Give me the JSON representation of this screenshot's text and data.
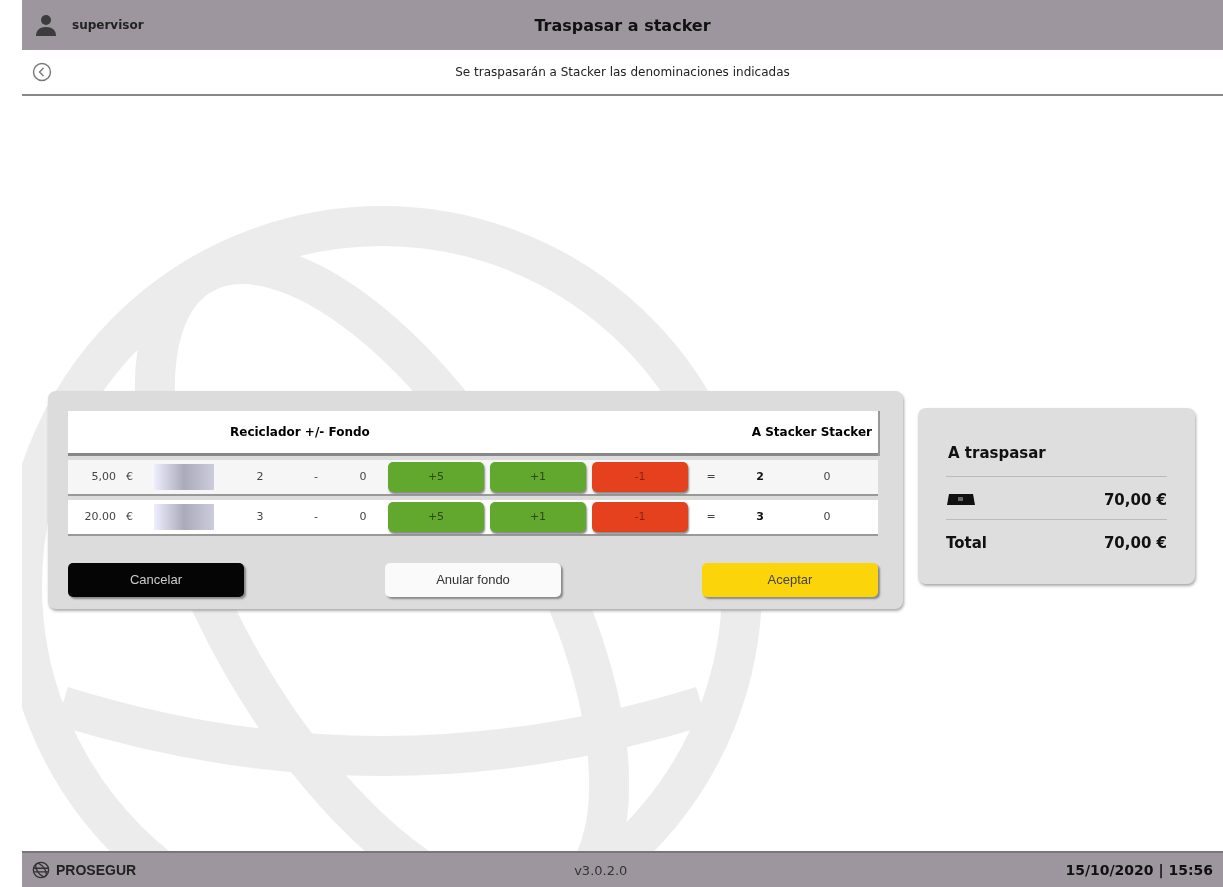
{
  "header": {
    "user": "supervisor",
    "title": "Traspasar a stacker"
  },
  "subheader": {
    "message": "Se traspasarán a Stacker las denominaciones indicadas"
  },
  "table": {
    "columns": [
      "Reciclador +/- Fondo",
      "A Stacker Stacker"
    ],
    "rows": [
      {
        "amount": "5,00",
        "currency": "€",
        "recycler": "2",
        "operator": "-",
        "fund": "0",
        "buttons": [
          {
            "label": "+5",
            "kind": "add"
          },
          {
            "label": "+1",
            "kind": "add"
          },
          {
            "label": "-1",
            "kind": "subtract"
          }
        ],
        "equals": "=",
        "to_stacker": "2",
        "stacker": "0"
      },
      {
        "amount": "20.00",
        "currency": "€",
        "recycler": "3",
        "operator": "-",
        "fund": "0",
        "buttons": [
          {
            "label": "+5",
            "kind": "add"
          },
          {
            "label": "+1",
            "kind": "add"
          },
          {
            "label": "-1",
            "kind": "subtract"
          }
        ],
        "equals": "=",
        "to_stacker": "3",
        "stacker": "0"
      }
    ]
  },
  "actions": [
    {
      "label": "Cancelar",
      "kind": "cancel"
    },
    {
      "label": "Anular fondo",
      "kind": "neutral"
    },
    {
      "label": "Aceptar",
      "kind": "confirm"
    }
  ],
  "summary": {
    "title": "A traspasar",
    "notes_amount": "70,00 €",
    "total_label": "Total",
    "total_amount": "70,00 €"
  },
  "footer": {
    "brand": "PROSEGUR",
    "version": "v3.0.2.0",
    "datetime": "15/10/2020 | 15:56"
  }
}
